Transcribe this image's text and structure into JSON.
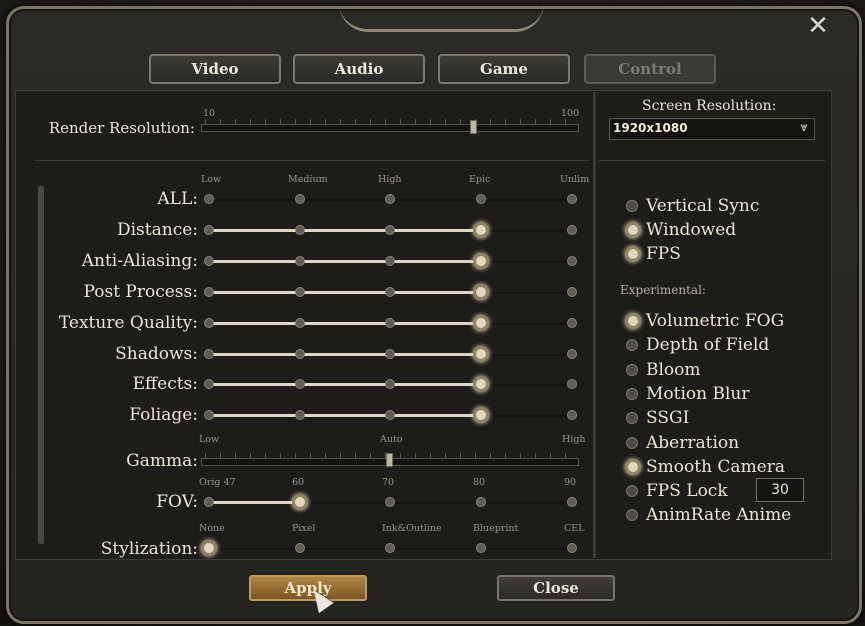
{
  "tabs": [
    {
      "label": "Video",
      "active": true
    },
    {
      "label": "Audio",
      "active": true
    },
    {
      "label": "Game",
      "active": true
    },
    {
      "label": "Control",
      "active": false
    }
  ],
  "render_resolution": {
    "label": "Render Resolution:",
    "min": "10",
    "max": "100",
    "value": 75
  },
  "screen_resolution": {
    "label": "Screen Resolution:",
    "value": "1920x1080"
  },
  "quality_levels": [
    "Low",
    "Medium",
    "High",
    "Epic",
    "Unlim"
  ],
  "quality_rows": [
    {
      "label": "ALL:",
      "selected": null
    },
    {
      "label": "Distance:",
      "selected": 3
    },
    {
      "label": "Anti-Aliasing:",
      "selected": 3
    },
    {
      "label": "Post Process:",
      "selected": 3
    },
    {
      "label": "Texture Quality:",
      "selected": 3
    },
    {
      "label": "Shadows:",
      "selected": 3
    },
    {
      "label": "Effects:",
      "selected": 3
    },
    {
      "label": "Foliage:",
      "selected": 3
    }
  ],
  "gamma": {
    "label": "Gamma:",
    "low": "Low",
    "mid": "Auto",
    "high": "High",
    "value": 0.5
  },
  "fov": {
    "label": "FOV:",
    "ticks": [
      "Orig 47",
      "60",
      "70",
      "80",
      "90"
    ],
    "selected": 1
  },
  "stylization": {
    "label": "Stylization:",
    "ticks": [
      "None",
      "Pixel",
      "Ink&Outline",
      "Blueprint",
      "CEL"
    ],
    "selected": 0
  },
  "options": [
    {
      "label": "Vertical Sync",
      "on": false
    },
    {
      "label": "Windowed",
      "on": true
    },
    {
      "label": "FPS",
      "on": true
    }
  ],
  "experimental_label": "Experimental:",
  "experimental": [
    {
      "label": "Volumetric FOG",
      "on": true
    },
    {
      "label": "Depth of Field",
      "on": false
    },
    {
      "label": "Bloom",
      "on": false
    },
    {
      "label": "Motion Blur",
      "on": false
    },
    {
      "label": "SSGI",
      "on": false
    },
    {
      "label": "Aberration",
      "on": false
    },
    {
      "label": "Smooth Camera",
      "on": true
    },
    {
      "label": "FPS Lock",
      "on": false
    },
    {
      "label": "AnimRate Anime",
      "on": false
    }
  ],
  "fps_lock_value": "30",
  "buttons": {
    "apply": "Apply",
    "close": "Close"
  },
  "icons": {
    "close": "close-icon",
    "dropdown": "chevron-down-icon"
  }
}
